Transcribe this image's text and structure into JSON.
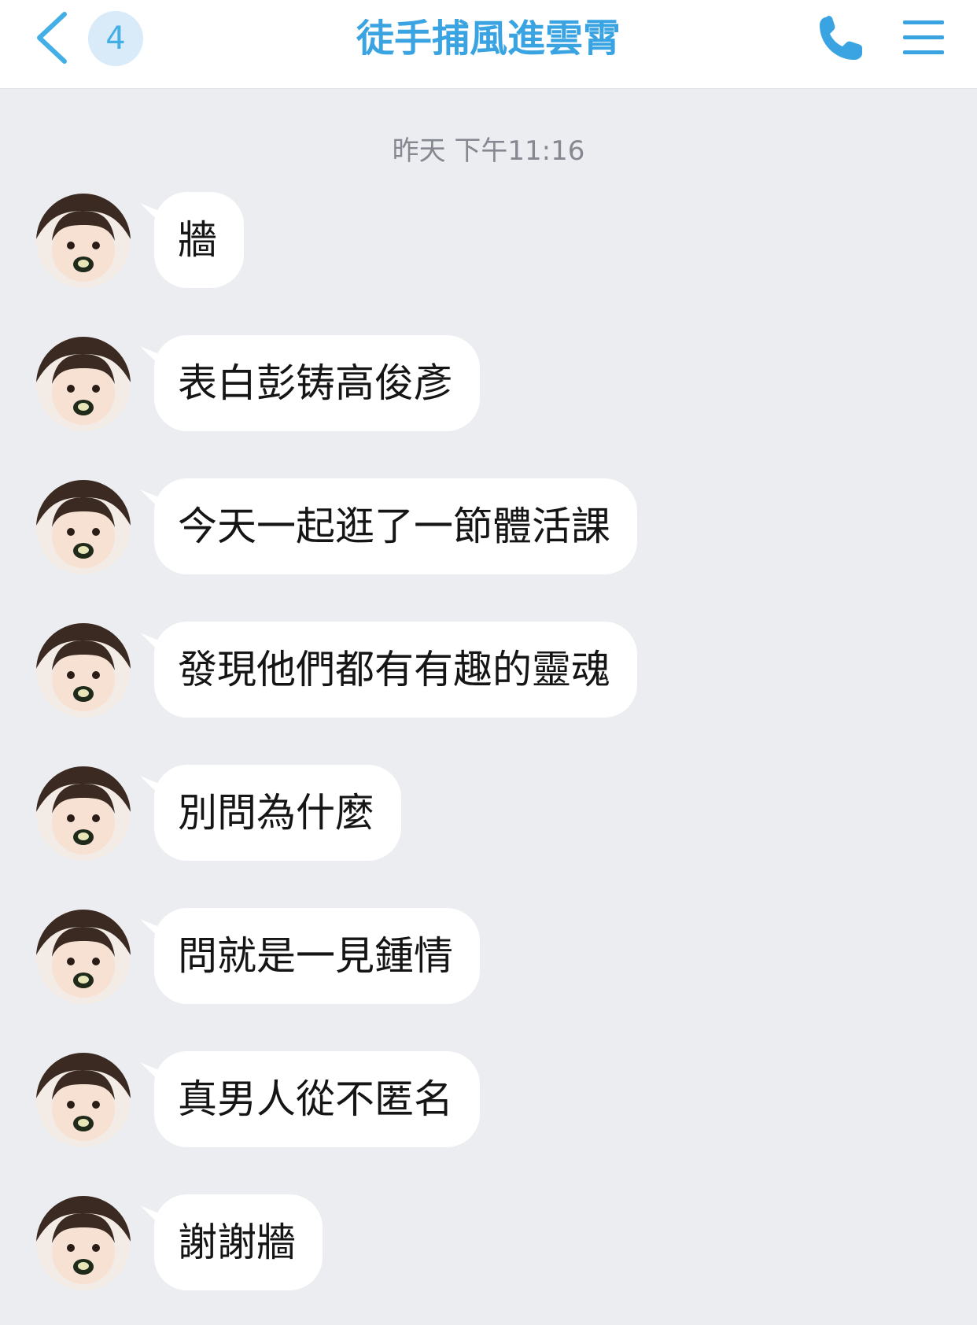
{
  "header": {
    "back_icon": "chevron-left-icon",
    "unread_count": "4",
    "title": "徒手捕風進雲霄",
    "call_icon": "phone-icon",
    "menu_icon": "hamburger-menu-icon",
    "accent_color": "#3aa4e3"
  },
  "chat": {
    "timestamp": "昨天 下午11:16",
    "messages": [
      {
        "text": "牆"
      },
      {
        "text": "表白彭铸高俊彥"
      },
      {
        "text": "今天一起逛了一節體活課"
      },
      {
        "text": "發現他們都有有趣的靈魂"
      },
      {
        "text": "別問為什麼"
      },
      {
        "text": "問就是一見鍾情"
      },
      {
        "text": "真男人從不匿名"
      },
      {
        "text": "謝謝牆"
      }
    ]
  }
}
